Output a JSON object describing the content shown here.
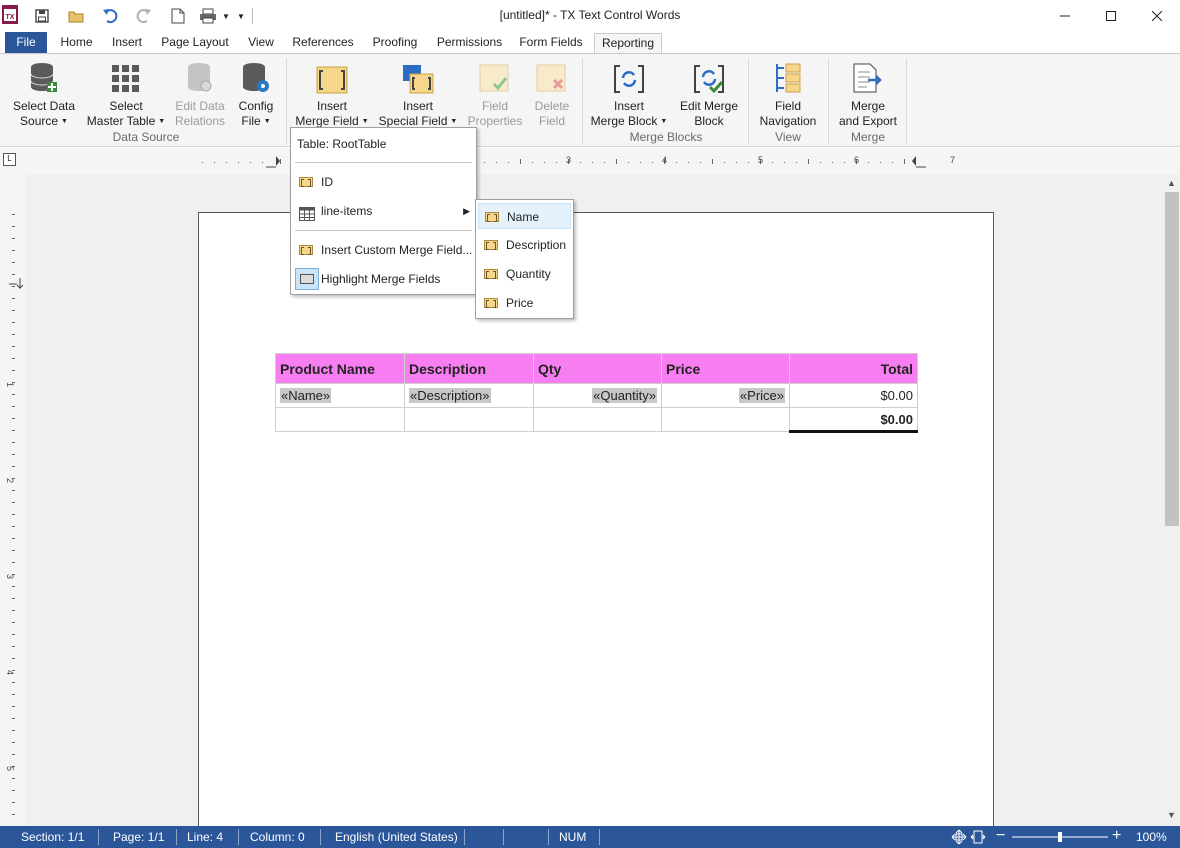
{
  "app": {
    "title": "[untitled]* - TX Text Control Words",
    "icon_label": "TX"
  },
  "qat": [
    "save-icon",
    "open-folder-icon",
    "undo-icon",
    "redo-icon",
    "new-document-icon",
    "print-icon"
  ],
  "tabs": [
    {
      "label": "File"
    },
    {
      "label": "Home"
    },
    {
      "label": "Insert"
    },
    {
      "label": "Page Layout"
    },
    {
      "label": "View"
    },
    {
      "label": "References"
    },
    {
      "label": "Proofing"
    },
    {
      "label": "Permissions"
    },
    {
      "label": "Form Fields"
    },
    {
      "label": "Reporting"
    }
  ],
  "ribbon": {
    "select_data_source": {
      "l1": "Select Data",
      "l2": "Source"
    },
    "select_master_table": {
      "l1": "Select",
      "l2": "Master Table"
    },
    "edit_data_relations": {
      "l1": "Edit Data",
      "l2": "Relations"
    },
    "config_file": {
      "l1": "Config",
      "l2": "File"
    },
    "insert_merge_field": {
      "l1": "Insert",
      "l2": "Merge Field"
    },
    "insert_special_field": {
      "l1": "Insert",
      "l2": "Special Field"
    },
    "field_properties": {
      "l1": "Field",
      "l2": "Properties"
    },
    "delete_field": {
      "l1": "Delete",
      "l2": "Field"
    },
    "insert_merge_block": {
      "l1": "Insert",
      "l2": "Merge Block"
    },
    "edit_merge_block": {
      "l1": "Edit Merge",
      "l2": "Block"
    },
    "field_navigation": {
      "l1": "Field",
      "l2": "Navigation"
    },
    "merge_and_export": {
      "l1": "Merge",
      "l2": "and Export"
    },
    "groups": {
      "data_source": "Data Source",
      "merge_blocks": "Merge Blocks",
      "view": "View",
      "merge": "Merge"
    }
  },
  "ruler": {
    "h_numbers": [
      "1",
      "2",
      "3",
      "4",
      "5",
      "6",
      "7"
    ],
    "v_numbers": [
      "1",
      "2",
      "3",
      "4",
      "5"
    ],
    "corner": "L"
  },
  "merge_menu": {
    "header": "Table: RootTable",
    "items": [
      "ID",
      "line-items",
      "Insert Custom Merge Field...",
      "Highlight Merge Fields"
    ]
  },
  "submenu": {
    "items": [
      "Name",
      "Description",
      "Quantity",
      "Price"
    ]
  },
  "table": {
    "headers": [
      "Product Name",
      "Description",
      "Qty",
      "Price",
      "Total"
    ],
    "fields": [
      "«Name»",
      "«Description»",
      "«Quantity»",
      "«Price»"
    ],
    "row_total": "$0.00",
    "grand_total": "$0.00",
    "header_color": "#f77ef0"
  },
  "status": {
    "section": "Section: 1/1",
    "page": "Page: 1/1",
    "line": "Line: 4",
    "column": "Column: 0",
    "language": "English (United States)",
    "num": "NUM",
    "zoom": "100%",
    "zoom_percent": 100
  },
  "colors": {
    "accent": "#2b579a",
    "file_tab": "#2b579a",
    "field_fill": "#f6d68b"
  }
}
